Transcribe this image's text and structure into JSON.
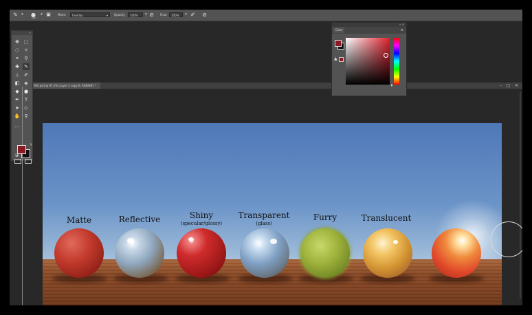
{
  "options_bar": {
    "brush_size": "100",
    "mode_label": "Mode:",
    "mode_value": "Overlay",
    "opacity_label": "Opacity:",
    "opacity_value": "100%",
    "flow_label": "Flow:",
    "flow_value": "100%"
  },
  "document": {
    "tab_title": "MO.psd @ 97.2% (Layer 2 copy 6, RGB/8#) *"
  },
  "color_panel": {
    "tab_label": "Color",
    "foreground_color": "#8b1a22",
    "background_color": "#111111"
  },
  "tools": {
    "foreground_color": "#8b1a22",
    "background_color": "#111111"
  },
  "spheres": [
    {
      "label": "Matte",
      "sub": ""
    },
    {
      "label": "Reflective",
      "sub": ""
    },
    {
      "label": "Shiny",
      "sub": "(specular/glossy)"
    },
    {
      "label": "Transparent",
      "sub": "(glass)"
    },
    {
      "label": "Furry",
      "sub": ""
    },
    {
      "label": "Translucent",
      "sub": ""
    }
  ]
}
